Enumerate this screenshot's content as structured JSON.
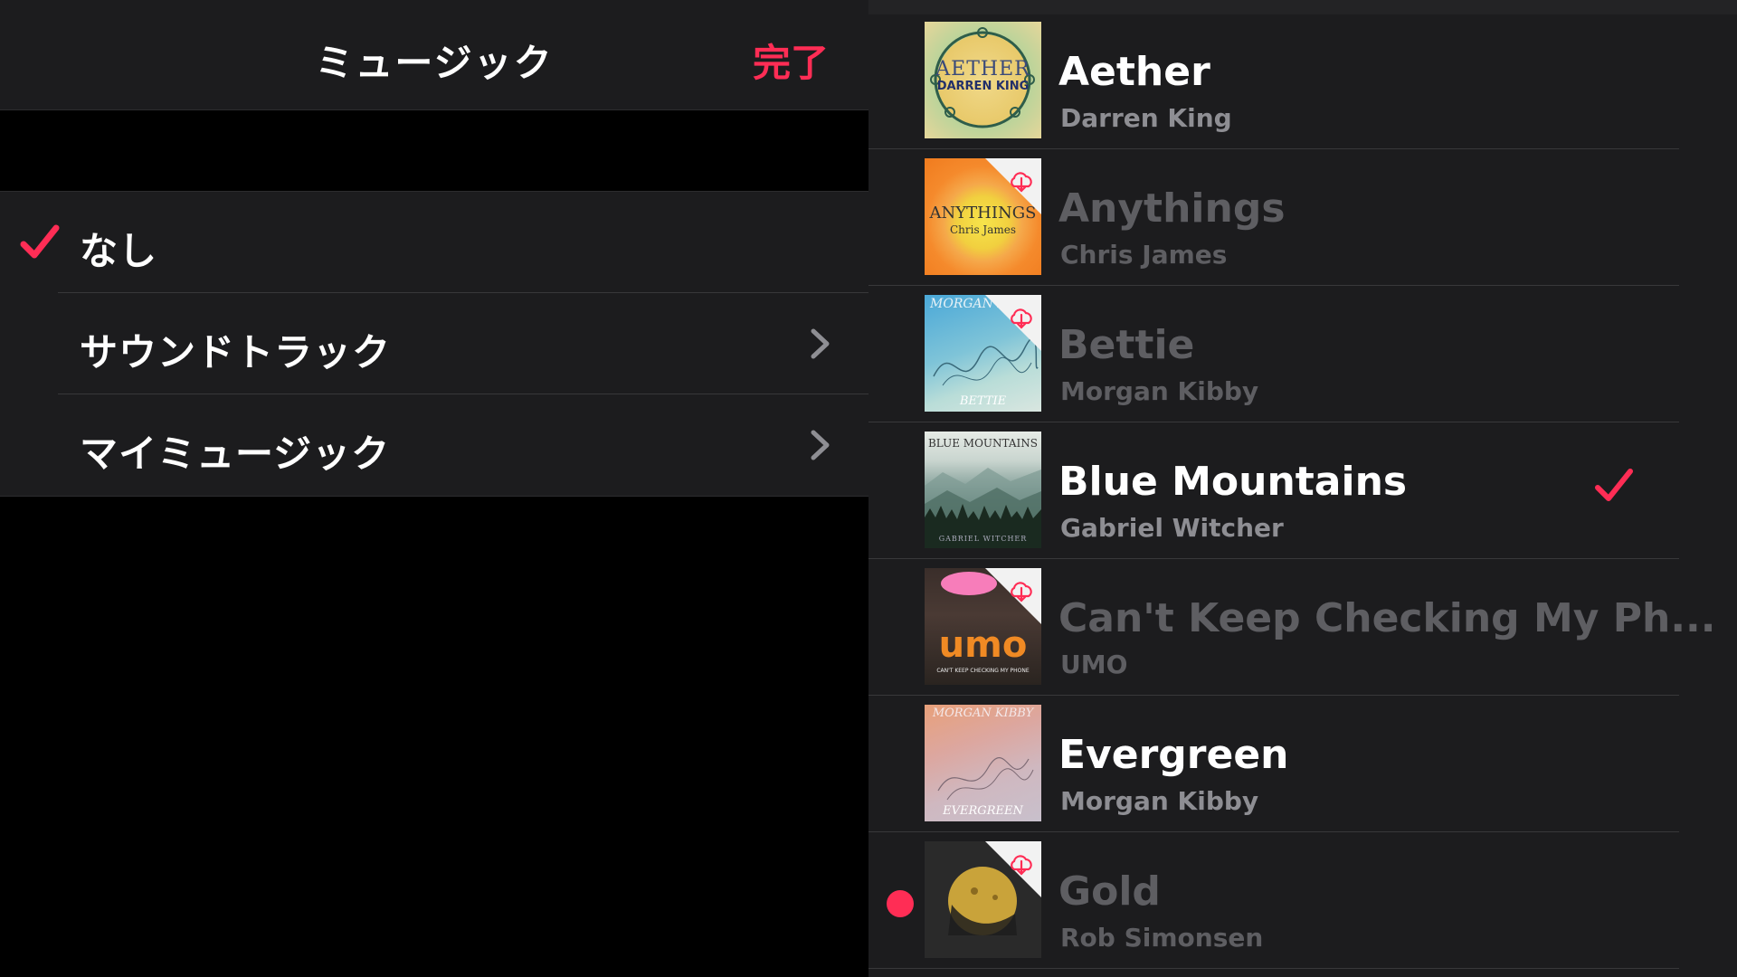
{
  "navbar": {
    "title": "ミュージック",
    "done_label": "完了"
  },
  "menu": {
    "items": [
      {
        "label": "なし",
        "checked": true,
        "has_chevron": false
      },
      {
        "label": "サウンドトラック",
        "checked": false,
        "has_chevron": true
      },
      {
        "label": "マイミュージック",
        "checked": false,
        "has_chevron": true
      }
    ]
  },
  "songs": [
    {
      "title": "Aether",
      "artist": "Darren King",
      "downloaded": true,
      "checked": false,
      "art_text": [
        "AETHER",
        "DARREN KING"
      ]
    },
    {
      "title": "Anythings",
      "artist": "Chris James",
      "downloaded": false,
      "checked": false,
      "art_text": [
        "ANYTHINGS",
        "Chris James"
      ]
    },
    {
      "title": "Bettie",
      "artist": "Morgan Kibby",
      "downloaded": false,
      "checked": false,
      "art_text": [
        "MORGAN K",
        "BETTIE"
      ]
    },
    {
      "title": "Blue Mountains",
      "artist": "Gabriel Witcher",
      "downloaded": true,
      "checked": true,
      "art_text": [
        "BLUE MOUNTAINS",
        "GABRIEL WITCHER"
      ]
    },
    {
      "title": "Can't Keep Checking My Ph...",
      "artist": "UMO",
      "downloaded": false,
      "checked": false,
      "art_text": [
        "umo",
        "CAN'T KEEP CHECKING MY PHONE"
      ]
    },
    {
      "title": "Evergreen",
      "artist": "Morgan Kibby",
      "downloaded": true,
      "checked": false,
      "art_text": [
        "MORGAN KIBBY",
        "EVERGREEN"
      ]
    },
    {
      "title": "Gold",
      "artist": "Rob Simonsen",
      "downloaded": false,
      "checked": false,
      "art_text": []
    }
  ],
  "colors": {
    "accent": "#ff2d55",
    "background": "#000000",
    "panel": "#1c1c1e",
    "secondary_text": "#8e8e93",
    "dim_text": "#5e5e62"
  },
  "icons": {
    "check": "checkmark-icon",
    "chevron": "chevron-right-icon",
    "cloud": "cloud-download-icon",
    "record": "record-dot-icon"
  }
}
